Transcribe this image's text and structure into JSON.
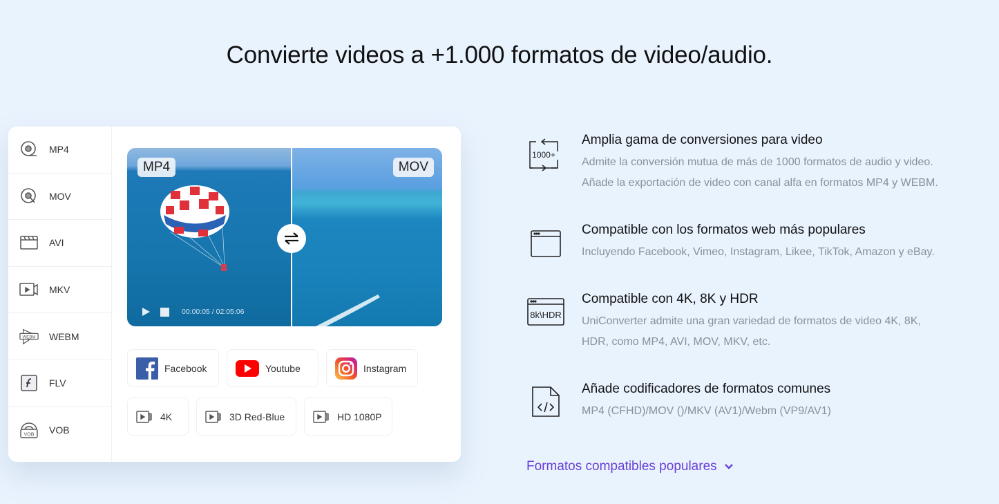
{
  "page": {
    "title": "Convierte videos a +1.000 formatos de video/audio."
  },
  "formats_sidebar": {
    "items": [
      {
        "label": "MP4",
        "icon": "disc-icon"
      },
      {
        "label": "MOV",
        "icon": "disc-search-icon"
      },
      {
        "label": "AVI",
        "icon": "clapperboard-icon"
      },
      {
        "label": "MKV",
        "icon": "video-camera-icon"
      },
      {
        "label": "WEBM",
        "icon": "webm-icon"
      },
      {
        "label": "FLV",
        "icon": "flash-icon"
      },
      {
        "label": "VOB",
        "icon": "vob-icon"
      }
    ]
  },
  "video_preview": {
    "source_format": "MP4",
    "target_format": "MOV",
    "current_time": "00:00:05",
    "total_time": "02:05:06",
    "time_display": "00:00:05 / 02:05:06",
    "swap_icon": "swap-arrows-icon"
  },
  "platform_chips": [
    {
      "label": "Facebook",
      "icon": "facebook-icon",
      "color": "#3b5998"
    },
    {
      "label": "Youtube",
      "icon": "youtube-icon",
      "color": "#ff0000"
    },
    {
      "label": "Instagram",
      "icon": "instagram-icon",
      "color": "#e1306c"
    }
  ],
  "quality_chips": [
    {
      "label": "4K",
      "icon": "video-camera-icon"
    },
    {
      "label": "3D Red-Blue",
      "icon": "video-camera-icon"
    },
    {
      "label": "HD 1080P",
      "icon": "video-camera-icon"
    }
  ],
  "features": [
    {
      "icon": "1000-plus-convert-icon",
      "icon_text": "1000+",
      "title": "Amplia gama de conversiones para video",
      "description_lines": [
        "Admite la conversión mutua de más de 1000 formatos de audio y video.",
        "Añade la exportación de video con canal alfa en formatos MP4 y WEBM."
      ]
    },
    {
      "icon": "browser-window-icon",
      "title": "Compatible con los formatos web más populares",
      "description_lines": [
        "Incluyendo Facebook, Vimeo, Instagram, Likee, TikTok, Amazon y eBay."
      ]
    },
    {
      "icon": "8k-hdr-icon",
      "icon_text": "8k\\HDR",
      "title": "Compatible con 4K, 8K y HDR",
      "description_lines": [
        "UniConverter admite una gran variedad de formatos de video 4K, 8K,",
        "HDR, como MP4, AVI, MOV, MKV, etc."
      ]
    },
    {
      "icon": "code-file-icon",
      "title": "Añade codificadores de formatos comunes",
      "description_lines": [
        "MP4 (CFHD)/MOV ()/MKV (AV1)/Webm (VP9/AV1)"
      ]
    }
  ],
  "more_link": {
    "label": "Formatos compatibles populares",
    "icon": "chevron-down-icon",
    "color": "#6a3fd6"
  }
}
